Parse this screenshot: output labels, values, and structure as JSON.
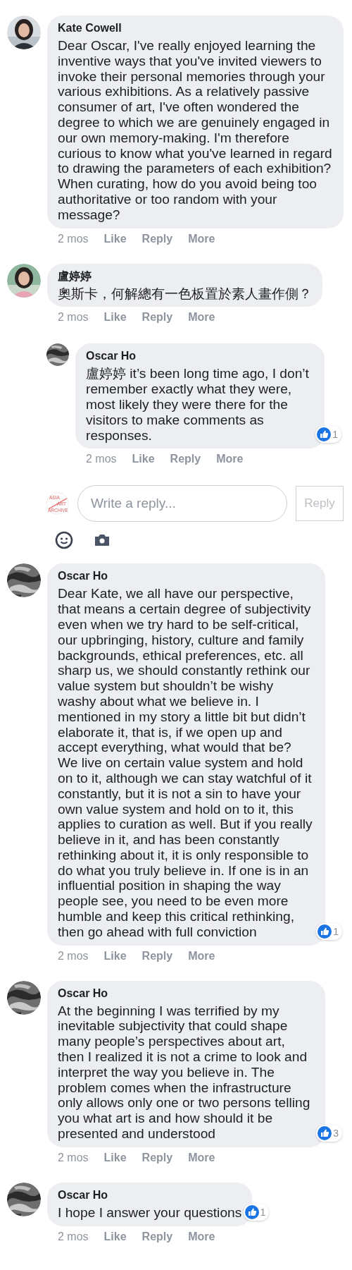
{
  "comments": [
    {
      "avatar": {
        "kind": "portrait"
      },
      "name": "Kate Cowell",
      "text": "Dear Oscar, I've really enjoyed learning the inventive ways that you've invited viewers to invoke their personal memories through your various exhibitions. As a relatively passive consumer of art, I've often wondered the degree to which we are genuinely engaged in our own memory-making. I'm therefore curious to know what you've learned in regard to drawing the parameters of each exhibition? When curating, how do you avoid being too authoritative or too random with your message?",
      "time": "2 mos",
      "actions": [
        "Like",
        "Reply",
        "More"
      ]
    },
    {
      "avatar": {
        "kind": "portrait"
      },
      "name": "盧婷婷",
      "text": "奧斯卡，何解總有一色板置於素人畫作側？",
      "time": "2 mos",
      "actions": [
        "Like",
        "Reply",
        "More"
      ],
      "replies": [
        {
          "avatar": {
            "kind": "texture"
          },
          "name": "Oscar Ho",
          "text": "盧婷婷 it’s been long time ago, I don’t remember exactly what they were, most likely they were there for the visitors to make comments as responses.",
          "reactions": "1",
          "time": "2 mos",
          "actions": [
            "Like",
            "Reply",
            "More"
          ]
        }
      ],
      "composer": {
        "logo": [
          "ASIA",
          "ART",
          "ARCHIVE"
        ],
        "placeholder": "Write a reply...",
        "button": {
          "label": "Reply",
          "disabled": true
        }
      }
    },
    {
      "avatar": {
        "kind": "texture"
      },
      "name": "Oscar Ho",
      "text": "Dear Kate, we all have our perspective, that means a certain degree of subjectivity even when we try hard to be self-critical, our upbringing, history, culture and family backgrounds, ethical preferences, etc. all sharp us, we should constantly rethink our value system but shouldn’t be wishy washy about what we believe in. I mentioned in my story a little bit but didn’t elaborate it, that is, if we open up and accept everything, what would that be? We live on certain value system and hold on to it, although we can stay watchful of it constantly, but it is not a sin to have your own value system and hold on to it, this applies to curation as well. But if you really believe in it, and has been constantly rethinking about it, it is only responsible to do what you truly believe in. If one is in an influential position in shaping the way people see, you need to be even more humble and keep this critical rethinking, then go ahead with full conviction",
      "reactions": "1",
      "time": "2 mos",
      "actions": [
        "Like",
        "Reply",
        "More"
      ]
    },
    {
      "avatar": {
        "kind": "texture"
      },
      "name": "Oscar Ho",
      "text": "At the beginning I was terrified by my inevitable subjectivity that could shape many people’s perspectives about art, then I realized it is not a crime to look and interpret the way you believe in. The problem comes when the infrastructure only allows only one or two persons telling you what art is and how should it be presented and understood",
      "reactions": "3",
      "time": "2 mos",
      "actions": [
        "Like",
        "Reply",
        "More"
      ]
    },
    {
      "avatar": {
        "kind": "texture"
      },
      "name": "Oscar Ho",
      "text": "I hope I answer your questions",
      "reactions": "1",
      "time": "2 mos",
      "actions": [
        "Like",
        "Reply",
        "More"
      ]
    }
  ]
}
